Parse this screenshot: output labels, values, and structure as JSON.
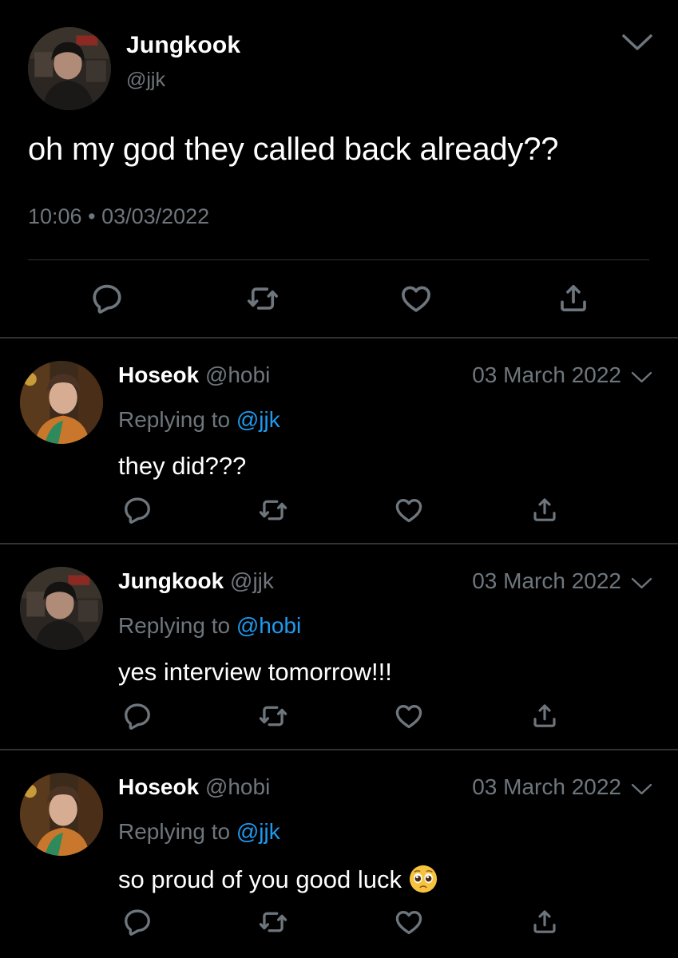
{
  "colors": {
    "background": "#000000",
    "text": "#ffffff",
    "muted": "#6e767d",
    "mention": "#1d9bf0",
    "divider": "#2f3336"
  },
  "main_tweet": {
    "name": "Jungkook",
    "handle": "@jjk",
    "text": "oh my god they called back already??",
    "time": "10:06",
    "separator": "•",
    "date": "03/03/2022",
    "actions": [
      "reply-icon",
      "retweet-icon",
      "like-icon",
      "share-icon"
    ]
  },
  "replies": [
    {
      "name": "Hoseok",
      "handle": "@hobi",
      "date": "03 March 2022",
      "replying_label": "Replying to",
      "replying_to": "@jjk",
      "text": "they did???"
    },
    {
      "name": "Jungkook",
      "handle": "@jjk",
      "date": "03 March 2022",
      "replying_label": "Replying to",
      "replying_to": "@hobi",
      "text": "yes interview tomorrow!!!"
    },
    {
      "name": "Hoseok",
      "handle": "@hobi",
      "date": "03 March 2022",
      "replying_label": "Replying to",
      "replying_to": "@jjk",
      "text": "so proud of you good luck",
      "emoji": "pleading-face-emoji"
    }
  ]
}
